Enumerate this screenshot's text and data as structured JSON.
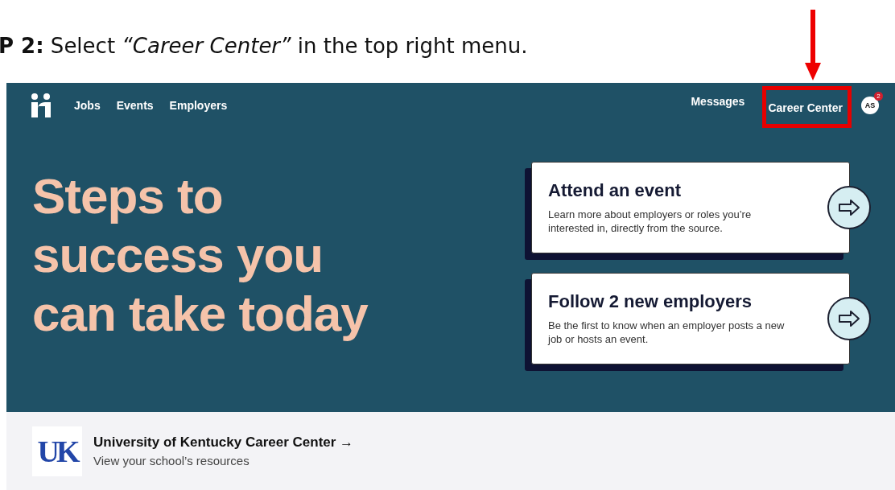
{
  "instruction": "**P 2:** Select *“Career Center”* in the top right menu.",
  "nav": {
    "left": [
      {
        "label": "Jobs"
      },
      {
        "label": "Events"
      },
      {
        "label": "Employers"
      }
    ],
    "right": [
      {
        "label": "Messages",
        "highlighted": false
      },
      {
        "label": "Career Center",
        "highlighted": true
      }
    ],
    "avatar": {
      "initials": "AS",
      "badge": "2"
    }
  },
  "hero": {
    "title_lines": [
      "Steps to",
      "success you",
      "can take today"
    ],
    "cards": [
      {
        "title": "Attend an event",
        "text": "Learn more about employers or roles you’re interested in, directly from the source."
      },
      {
        "title": "Follow 2 new employers",
        "text": "Be the first to know when an employer posts a new job or hosts an event."
      }
    ]
  },
  "school": {
    "logo": "UK",
    "name": "University of Kentucky Career Center →",
    "subtitle": "View your school’s resources"
  }
}
